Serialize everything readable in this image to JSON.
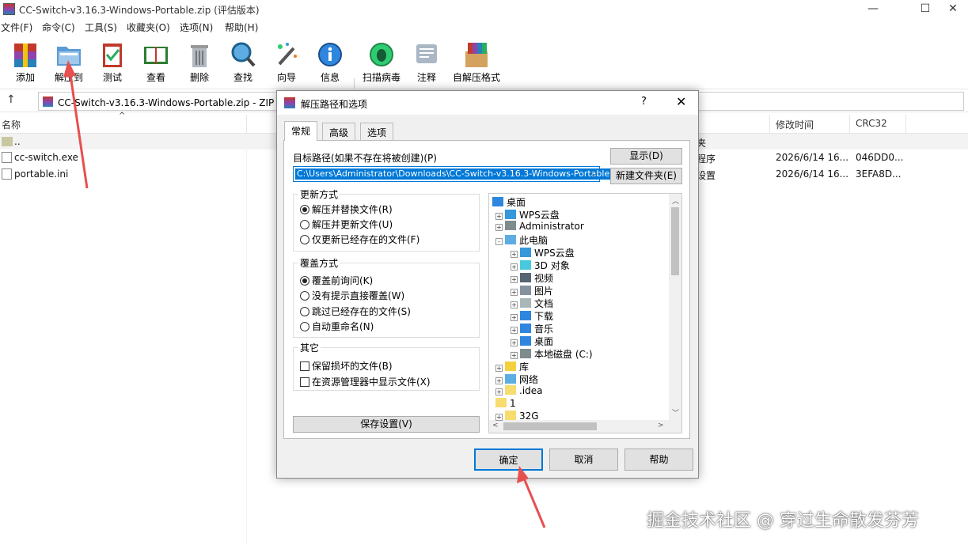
{
  "window": {
    "title": "CC-Switch-v3.16.3-Windows-Portable.zip (评估版本)",
    "min": "—",
    "max": "☐",
    "close": "✕"
  },
  "menu": [
    "文件(F)",
    "命令(C)",
    "工具(S)",
    "收藏夹(O)",
    "选项(N)",
    "帮助(H)"
  ],
  "toolbar": {
    "add": "添加",
    "extract": "解压到",
    "test": "测试",
    "view": "查看",
    "delete": "删除",
    "find": "查找",
    "wizard": "向导",
    "info": "信息",
    "scan": "扫描病毒",
    "comment": "注释",
    "sfx": "自解压格式"
  },
  "address": {
    "up": "↑",
    "path": "CC-Switch-v3.16.3-Windows-Portable.zip - ZIP 压"
  },
  "columns": {
    "name": "名称",
    "sort": "^",
    "type": "",
    "modified": "修改时间",
    "crc": "CRC32"
  },
  "files": [
    {
      "name": "..",
      "type": "文件夹",
      "modified": "",
      "crc": ""
    },
    {
      "name": "cc-switch.exe",
      "type": "应用程序",
      "modified": "2026/6/14 16...",
      "crc": "046DD0..."
    },
    {
      "name": "portable.ini",
      "type": "配置设置",
      "modified": "2026/6/14 16...",
      "crc": "3EFA8D..."
    }
  ],
  "dialog": {
    "title": "解压路径和选项",
    "help": "?",
    "close": "✕",
    "tabs": [
      "常规",
      "高级",
      "选项"
    ],
    "path_label": "目标路径(如果不存在将被创建)(P)",
    "path_value": "C:\\Users\\Administrator\\Downloads\\CC-Switch-v3.16.3-Windows-Portable",
    "show_button": "显示(D)",
    "new_folder_button": "新建文件夹(E)",
    "update_group": {
      "title": "更新方式",
      "options": [
        "解压并替换文件(R)",
        "解压并更新文件(U)",
        "仅更新已经存在的文件(F)"
      ],
      "selected": 0
    },
    "overwrite_group": {
      "title": "覆盖方式",
      "options": [
        "覆盖前询问(K)",
        "没有提示直接覆盖(W)",
        "跳过已经存在的文件(S)",
        "自动重命名(N)"
      ],
      "selected": 0
    },
    "other_group": {
      "title": "其它",
      "options": [
        "保留损坏的文件(B)",
        "在资源管理器中显示文件(X)"
      ]
    },
    "save_button": "保存设置(V)",
    "tree": [
      {
        "label": "桌面",
        "level": 0,
        "icon": "desktop-icon",
        "exp": ""
      },
      {
        "label": "WPS云盘",
        "level": 1,
        "icon": "cloud-icon",
        "exp": "+"
      },
      {
        "label": "Administrator",
        "level": 1,
        "icon": "user-icon",
        "exp": "+"
      },
      {
        "label": "此电脑",
        "level": 1,
        "icon": "computer-icon",
        "exp": "-"
      },
      {
        "label": "WPS云盘",
        "level": 2,
        "icon": "cloud-icon",
        "exp": "+"
      },
      {
        "label": "3D 对象",
        "level": 2,
        "icon": "cube-icon",
        "exp": "+"
      },
      {
        "label": "视频",
        "level": 2,
        "icon": "video-icon",
        "exp": "+"
      },
      {
        "label": "图片",
        "level": 2,
        "icon": "picture-icon",
        "exp": "+"
      },
      {
        "label": "文档",
        "level": 2,
        "icon": "document-icon",
        "exp": "+"
      },
      {
        "label": "下载",
        "level": 2,
        "icon": "download-icon",
        "exp": "+"
      },
      {
        "label": "音乐",
        "level": 2,
        "icon": "music-icon",
        "exp": "+"
      },
      {
        "label": "桌面",
        "level": 2,
        "icon": "desktop-icon",
        "exp": "+"
      },
      {
        "label": "本地磁盘 (C:)",
        "level": 2,
        "icon": "disk-icon",
        "exp": "+"
      },
      {
        "label": "库",
        "level": 1,
        "icon": "library-icon",
        "exp": "+"
      },
      {
        "label": "网络",
        "level": 1,
        "icon": "network-icon",
        "exp": "+"
      },
      {
        "label": ".idea",
        "level": 1,
        "icon": "folder-icon",
        "exp": "+"
      },
      {
        "label": "1",
        "level": 1,
        "icon": "folder-icon",
        "exp": ""
      },
      {
        "label": "32G",
        "level": 1,
        "icon": "folder-icon",
        "exp": "+"
      }
    ],
    "ok_button": "确定",
    "cancel_button": "取消",
    "help_button": "帮助"
  },
  "watermark": "掘金技术社区 @ 穿过生命散发芬芳",
  "colors": {
    "accent": "#0078d7",
    "arrow": "#e8504f"
  }
}
